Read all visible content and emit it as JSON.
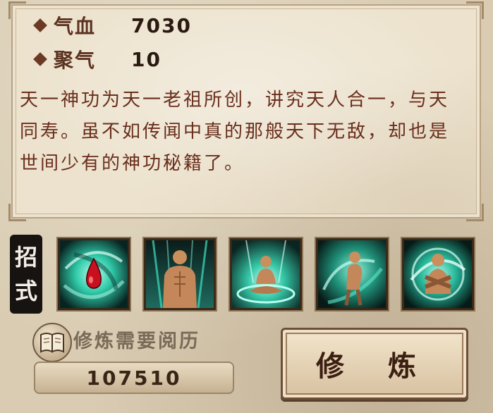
{
  "stats": [
    {
      "label": "气血",
      "value": "7030"
    },
    {
      "label": "聚气",
      "value": "10"
    }
  ],
  "description": "天一神功为天一老祖所创，讲究天人合一，与天同寿。虽不如传闻中真的那般天下无敌，却也是世间少有的神功秘籍了。",
  "moves_label": [
    "招",
    "式"
  ],
  "skills": [
    {
      "icon": "blood-drop-vortex-icon"
    },
    {
      "icon": "muscular-body-aura-icon"
    },
    {
      "icon": "meditation-aura-icon"
    },
    {
      "icon": "turning-body-swirl-icon"
    },
    {
      "icon": "crossed-arms-swirl-icon"
    }
  ],
  "requirement": {
    "label": "修炼需要阅历",
    "value": "107510",
    "icon": "book-icon"
  },
  "practice_button": {
    "label": "修 炼"
  },
  "colors": {
    "parchment": "#ece2cd",
    "text_brown": "#6a2e1c",
    "skill_glow": "#3fe0c0"
  }
}
